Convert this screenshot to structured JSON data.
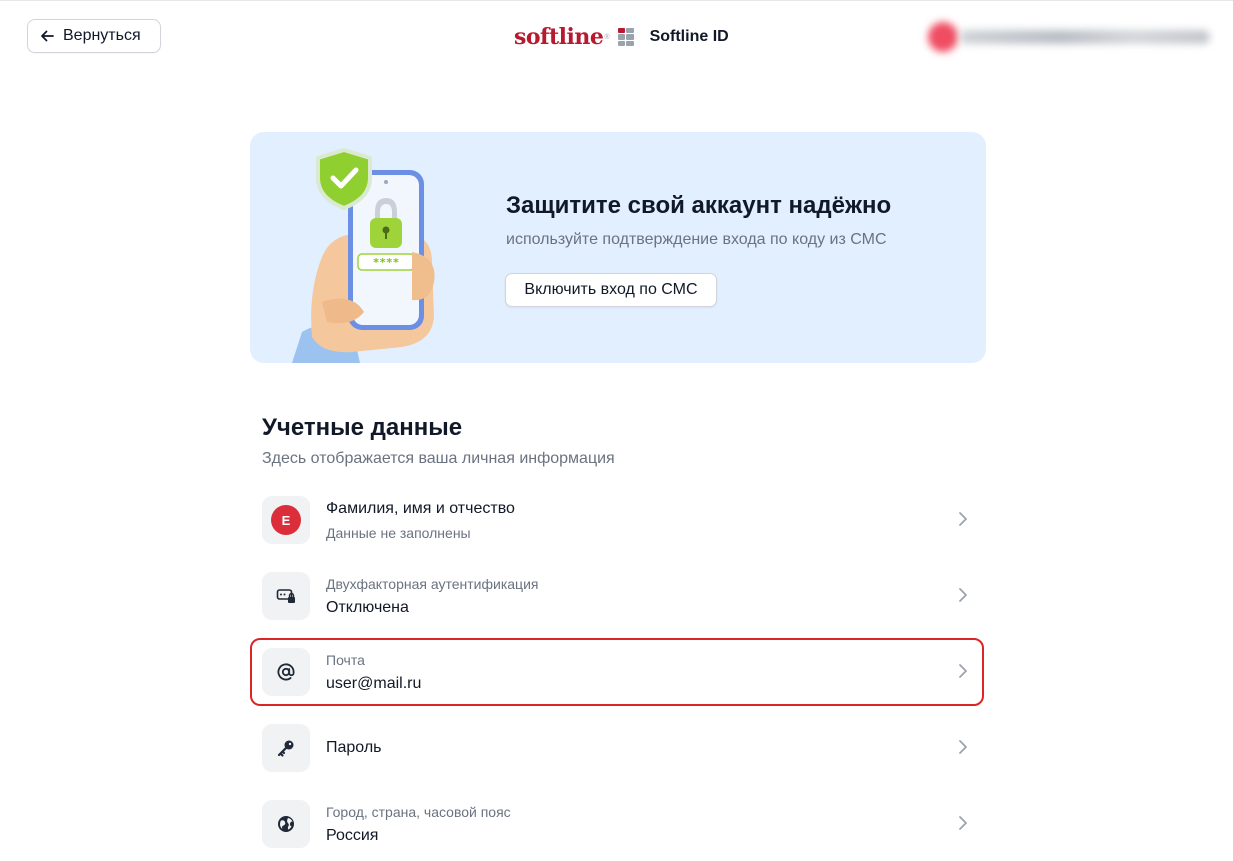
{
  "header": {
    "back_label": "Вернуться",
    "logo_text": "softline",
    "brand_name": "Softline ID"
  },
  "banner": {
    "title": "Защитите свой аккаунт надёжно",
    "subtitle": "используйте подтверждение входа по коду из СМС",
    "button_label": "Включить вход по СМС",
    "pin_mask": "****"
  },
  "section": {
    "title": "Учетные данные",
    "subtitle": "Здесь отображается ваша личная информация"
  },
  "rows": [
    {
      "icon": "avatar-initial",
      "avatar_initial": "Е",
      "primary": "Фамилия, имя и отчество",
      "secondary": "Данные не заполнены"
    },
    {
      "icon": "two-factor-icon",
      "label": "Двухфакторная аутентификация",
      "value": "Отключена"
    },
    {
      "icon": "at-sign-icon",
      "label": "Почта",
      "value": "user@mail.ru",
      "highlighted": true
    },
    {
      "icon": "key-icon",
      "primary": "Пароль"
    },
    {
      "icon": "globe-icon",
      "label": "Город, страна, часовой пояс",
      "value": "Россия"
    }
  ],
  "colors": {
    "brand_red": "#b8192f",
    "banner_bg": "#e1efff",
    "highlight_border": "#dc2626",
    "avatar_bg": "#dc2e3a"
  }
}
